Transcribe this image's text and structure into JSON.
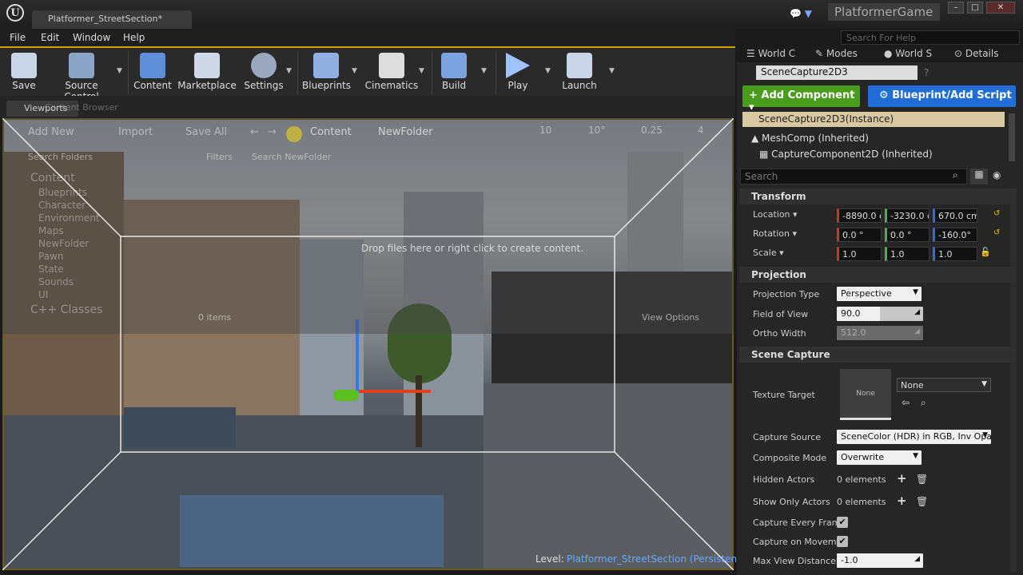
{
  "titlebar": {
    "doc_tab": "Platformer_StreetSection*",
    "project": "PlatformerGame",
    "logo": "U"
  },
  "menu": {
    "items": [
      "File",
      "Edit",
      "Window",
      "Help"
    ],
    "help_search": "Search For Help"
  },
  "toolbar": {
    "buttons": [
      {
        "label": "Save",
        "icon": "save-icon",
        "color": "#c9d6e8"
      },
      {
        "label": "Source Control",
        "icon": "source-control-icon",
        "color": "#8aa4c8"
      },
      {
        "label": "Content",
        "icon": "content-icon",
        "color": "#5f8fd9"
      },
      {
        "label": "Marketplace",
        "icon": "marketplace-icon",
        "color": "#cfd8e6"
      },
      {
        "label": "Settings",
        "icon": "settings-icon",
        "color": "#9aa7bf"
      },
      {
        "label": "Blueprints",
        "icon": "blueprints-icon",
        "color": "#8fb0e0"
      },
      {
        "label": "Cinematics",
        "icon": "cinematics-icon",
        "color": "#dddddd"
      },
      {
        "label": "Build",
        "icon": "build-icon",
        "color": "#7aa3e0"
      },
      {
        "label": "Play",
        "icon": "play-icon",
        "color": "#9fc3ff"
      },
      {
        "label": "Launch",
        "icon": "launch-icon",
        "color": "#c9d6e8"
      }
    ]
  },
  "tabs": {
    "viewport": "Viewports",
    "content_browser": "Content Browser"
  },
  "content_browser": {
    "add_new": "Add New",
    "import": "Import",
    "save_all": "Save All",
    "path_root": "Content",
    "path_folder": "NewFolder",
    "search_folders": "Search Folders",
    "filters": "Filters",
    "search_placeholder": "Search NewFolder",
    "folders": [
      "Content",
      "Blueprints",
      "Character",
      "Environment",
      "Maps",
      "NewFolder",
      "Pawn",
      "State",
      "Sounds",
      "UI",
      "C++ Classes"
    ],
    "drop_hint": "Drop files here or right click to create content.",
    "items_count": "0 items",
    "view_options": "View Options"
  },
  "viewport_toolbar": {
    "grid": "10",
    "rotation": "10°",
    "scale": "0.25",
    "cam": "4"
  },
  "viewport": {
    "level_label": "Level:",
    "level_name": "Platformer_StreetSection (Persistent)"
  },
  "right_panel": {
    "tabs": [
      "World C",
      "Modes",
      "World S",
      "Details"
    ],
    "actor_name": "SceneCapture2D3",
    "add_component": "Add Component",
    "blueprint_script": "Blueprint/Add Script",
    "components": {
      "root": "SceneCapture2D3(Instance)",
      "mesh": "MeshComp (Inherited)",
      "capture": "CaptureComponent2D (Inherited)"
    },
    "search": "Search",
    "transform": {
      "header": "Transform",
      "location_label": "Location",
      "location": [
        "-8890.0 c",
        "-3230.0 c",
        "670.0 cm"
      ],
      "rotation_label": "Rotation",
      "rotation": [
        "0.0 °",
        "0.0 °",
        "-160.0°"
      ],
      "scale_label": "Scale",
      "scale": [
        "1.0",
        "1.0",
        "1.0"
      ]
    },
    "projection": {
      "header": "Projection",
      "type_label": "Projection Type",
      "type": "Perspective",
      "fov_label": "Field of View",
      "fov": "90.0",
      "ortho_label": "Ortho Width",
      "ortho": "512.0"
    },
    "scene_capture": {
      "header": "Scene Capture",
      "texture_target_label": "Texture Target",
      "texture_thumb": "None",
      "texture_value": "None",
      "capture_source_label": "Capture Source",
      "capture_source": "SceneColor (HDR) in RGB, Inv Opa",
      "composite_mode_label": "Composite Mode",
      "composite_mode": "Overwrite",
      "hidden_actors_label": "Hidden Actors",
      "hidden_actors": "0 elements",
      "show_only_label": "Show Only Actors",
      "show_only": "0 elements",
      "capture_every_frame_label": "Capture Every Fram",
      "capture_on_movement_label": "Capture on Moveme",
      "max_view_label": "Max View Distance",
      "max_view": "-1.0"
    }
  }
}
